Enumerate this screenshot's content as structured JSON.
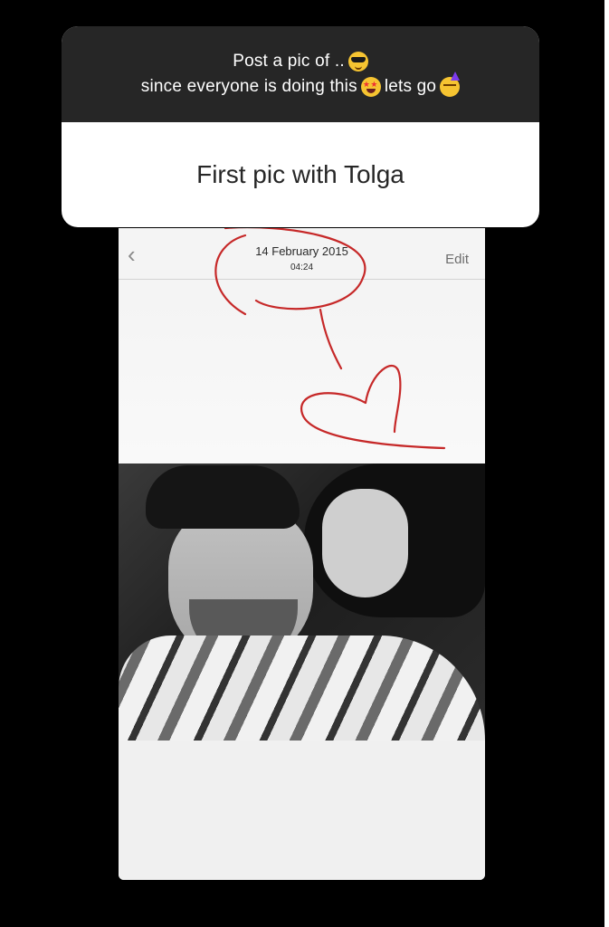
{
  "question_sticker": {
    "line1": "Post a pic of ..",
    "line2": "since everyone is doing this",
    "line2_tail": "lets go",
    "answer": "First pic with Tolga",
    "icons": [
      "sunglasses-emoji",
      "star-struck-emoji",
      "partying-face-emoji"
    ]
  },
  "photo_viewer": {
    "back_icon": "chevron-left-icon",
    "date": "14 February 2015",
    "time": "04:24",
    "edit_label": "Edit"
  },
  "colors": {
    "background": "#000000",
    "sticker_header": "#262626",
    "doodle_red": "#c62828"
  }
}
